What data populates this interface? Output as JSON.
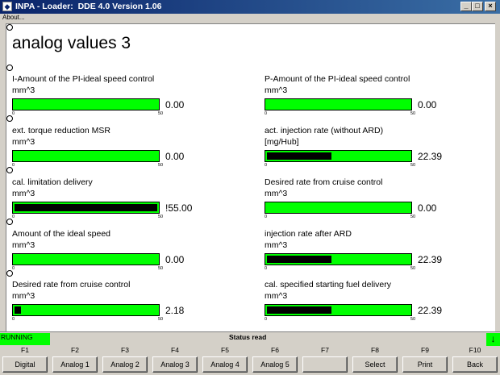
{
  "window": {
    "app_icon": "bmw-icon",
    "title": "INPA - Loader:  DDE 4.0 Version 1.06",
    "minimize": "_",
    "maximize": "□",
    "close": "×"
  },
  "menu": {
    "about": "About..."
  },
  "page": {
    "title": "analog values 3"
  },
  "gauges": [
    {
      "label": "I-Amount of the PI-ideal speed control",
      "unit": "mm^3",
      "value_text": "0.00",
      "fill": 0.0,
      "min": "0",
      "max": "50"
    },
    {
      "label": "P-Amount of the PI-ideal speed control",
      "unit": "mm^3",
      "value_text": "0.00",
      "fill": 0.0,
      "min": "0",
      "max": "50"
    },
    {
      "label": "ext. torque reduction MSR",
      "unit": "mm^3",
      "value_text": "0.00",
      "fill": 0.0,
      "min": "0",
      "max": "50"
    },
    {
      "label": "act. injection rate (without ARD)",
      "unit": "[mg/Hub]",
      "value_text": "22.39",
      "fill": 0.45,
      "min": "0",
      "max": "50"
    },
    {
      "label": "cal. limitation delivery",
      "unit": "mm^3",
      "value_text": "!55.00",
      "fill": 1.0,
      "min": "0",
      "max": "50"
    },
    {
      "label": "Desired rate from cruise control",
      "unit": "mm^3",
      "value_text": "0.00",
      "fill": 0.0,
      "min": "0",
      "max": "50"
    },
    {
      "label": "Amount of the ideal speed",
      "unit": "mm^3",
      "value_text": "0.00",
      "fill": 0.0,
      "min": "0",
      "max": "50"
    },
    {
      "label": "injection rate after ARD",
      "unit": "mm^3",
      "value_text": "22.39",
      "fill": 0.45,
      "min": "0",
      "max": "50"
    },
    {
      "label": "Desired rate from cruise control",
      "unit": "mm^3",
      "value_text": "2.18",
      "fill": 0.044,
      "min": "0",
      "max": "50"
    },
    {
      "label": "cal. specified starting fuel delivery",
      "unit": "mm^3",
      "value_text": "22.39",
      "fill": 0.45,
      "min": "0",
      "max": "50"
    }
  ],
  "status": {
    "state": "RUNNING",
    "message": "Status read",
    "arrow": "↓",
    "state_color": "#00ff00"
  },
  "fkeys": [
    {
      "key": "F1",
      "label": "Digital"
    },
    {
      "key": "F2",
      "label": "Analog 1"
    },
    {
      "key": "F3",
      "label": "Analog 2"
    },
    {
      "key": "F4",
      "label": "Analog 3"
    },
    {
      "key": "F5",
      "label": "Analog 4"
    },
    {
      "key": "F6",
      "label": "Analog 5"
    },
    {
      "key": "F7",
      "label": ""
    },
    {
      "key": "F8",
      "label": "Select"
    },
    {
      "key": "F9",
      "label": "Print"
    },
    {
      "key": "F10",
      "label": "Back"
    }
  ]
}
